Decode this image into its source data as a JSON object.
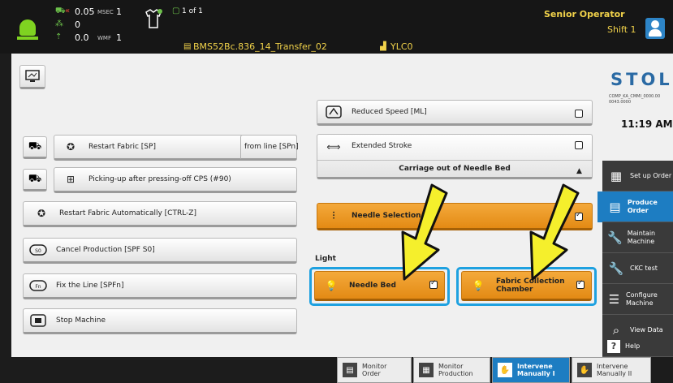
{
  "topbar": {
    "speed_value": "0.05",
    "speed_unit": "MSEC",
    "speed_index": "1",
    "counter_value": "0",
    "wmf_value": "0.0",
    "wmf_unit": "WMF",
    "wmf_index": "1",
    "piece_count": "1 of 1",
    "filename": "BMS52Bc.836_14_Transfer_02",
    "machine_id": "YLC0",
    "user_role": "Senior Operator",
    "shift": "Shift 1"
  },
  "brand": {
    "logo_text": "STOLL",
    "info_line1": "COMP_KA_CMMI_0000.00",
    "info_line2": "0043.0000",
    "time": "11:19 AM"
  },
  "left_buttons": {
    "restart_fabric": "Restart Fabric [SP]",
    "from_line": "from line [SPn]",
    "picking_up": "Picking-up after pressing-off CPS (#90)",
    "restart_auto": "Restart Fabric Automatically [CTRL-Z]",
    "cancel_production": "Cancel Production [SPF S0]",
    "fix_line": "Fix the Line [SPFn]",
    "stop_machine": "Stop Machine"
  },
  "middle": {
    "reduced_speed": "Reduced Speed [ML]",
    "extended_stroke": "Extended Stroke",
    "carriage_out": "Carriage out of Needle Bed",
    "needle_selection": "Needle Selection",
    "light_heading": "Light",
    "needle_bed": "Needle Bed",
    "fabric_collection": "Fabric Collection Chamber"
  },
  "checkboxes": {
    "reduced_speed": false,
    "extended_stroke": false,
    "needle_selection": true,
    "needle_bed": true,
    "fabric_collection": true
  },
  "nav": [
    {
      "label": "Set up Order",
      "icon": "setup-order-icon"
    },
    {
      "label": "Produce Order",
      "icon": "produce-order-icon"
    },
    {
      "label": "Maintain Machine",
      "icon": "wrench-icon"
    },
    {
      "label": "CKC test",
      "icon": "wrench-icon"
    },
    {
      "label": "Configure Machine",
      "icon": "configure-icon"
    },
    {
      "label": "View Data",
      "icon": "view-data-icon"
    },
    {
      "label": "Help",
      "icon": "help-icon"
    }
  ],
  "bottom_tabs": [
    {
      "label": "Monitor Order"
    },
    {
      "label": "Monitor Production"
    },
    {
      "label": "Intervene Manually I"
    },
    {
      "label": "Intervene Manually II"
    }
  ],
  "colors": {
    "accent_blue": "#1d7dc2",
    "orange": "#f0a030",
    "arrow_yellow": "#f5ef2c",
    "status_green": "#7fd321"
  }
}
